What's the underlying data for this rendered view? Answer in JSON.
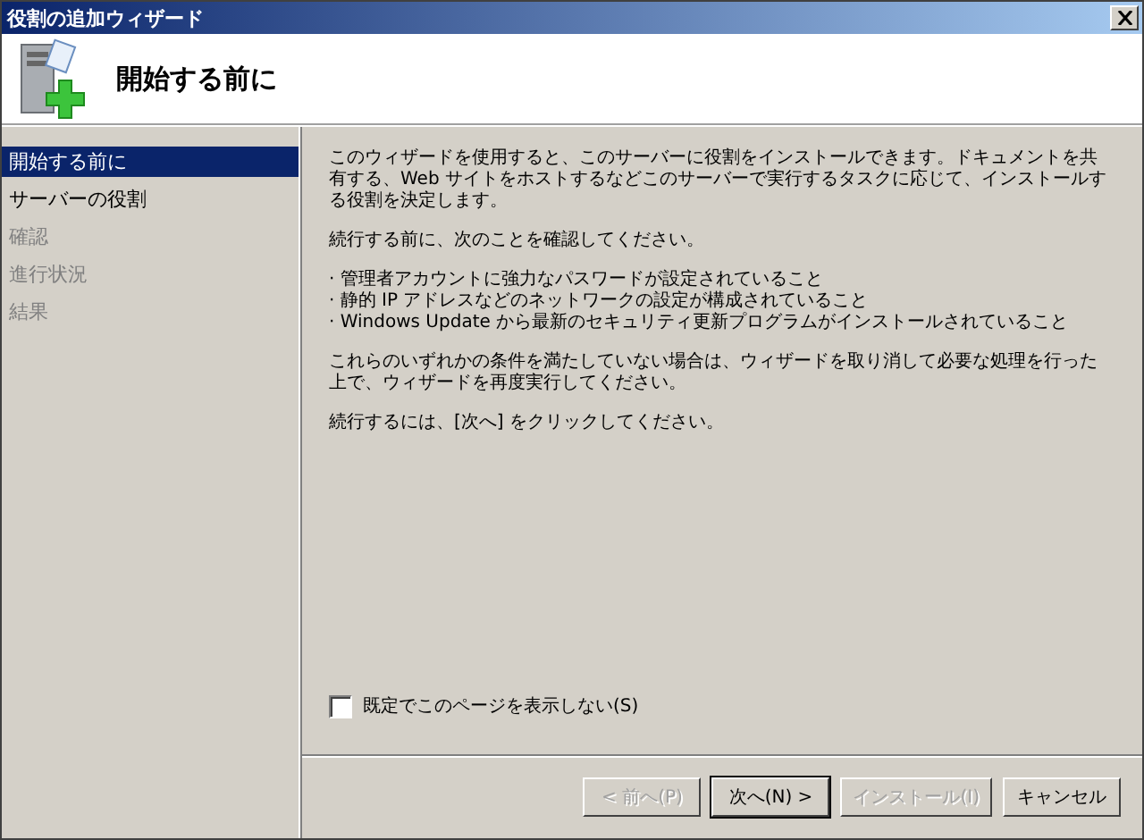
{
  "window": {
    "title": "役割の追加ウィザード"
  },
  "header": {
    "title": "開始する前に"
  },
  "sidebar": {
    "items": [
      {
        "label": "開始する前に",
        "selected": true,
        "disabled": false
      },
      {
        "label": "サーバーの役割",
        "selected": false,
        "disabled": false
      },
      {
        "label": "確認",
        "selected": false,
        "disabled": true
      },
      {
        "label": "進行状況",
        "selected": false,
        "disabled": true
      },
      {
        "label": "結果",
        "selected": false,
        "disabled": true
      }
    ]
  },
  "content": {
    "blocks": [
      {
        "kind": "paragraph",
        "text": "このウィザードを使用すると、このサーバーに役割をインストールできます。ドキュメントを共有する、Web サイトをホストするなどこのサーバーで実行するタスクに応じて、インストールする役割を決定します。"
      },
      {
        "kind": "paragraph",
        "text": "続行する前に、次のことを確認してください。"
      },
      {
        "kind": "list",
        "items": [
          "· 管理者アカウントに強力なパスワードが設定されていること",
          "· 静的 IP アドレスなどのネットワークの設定が構成されていること",
          "· Windows Update から最新のセキュリティ更新プログラムがインストールされていること"
        ]
      },
      {
        "kind": "paragraph",
        "text": "これらのいずれかの条件を満たしていない場合は、ウィザードを取り消して必要な処理を行った上で、ウィザードを再度実行してください。"
      },
      {
        "kind": "paragraph",
        "text": "続行するには、[次へ] をクリックしてください。"
      }
    ],
    "skip_checkbox": {
      "label": "既定でこのページを表示しない(S)",
      "checked": false
    }
  },
  "buttons": [
    {
      "label": "< 前へ(P)",
      "disabled": true,
      "default": false
    },
    {
      "label": "次へ(N) >",
      "disabled": false,
      "default": true
    },
    {
      "label": "インストール(I)",
      "disabled": true,
      "default": false
    },
    {
      "label": "キャンセル",
      "disabled": false,
      "default": false
    }
  ]
}
